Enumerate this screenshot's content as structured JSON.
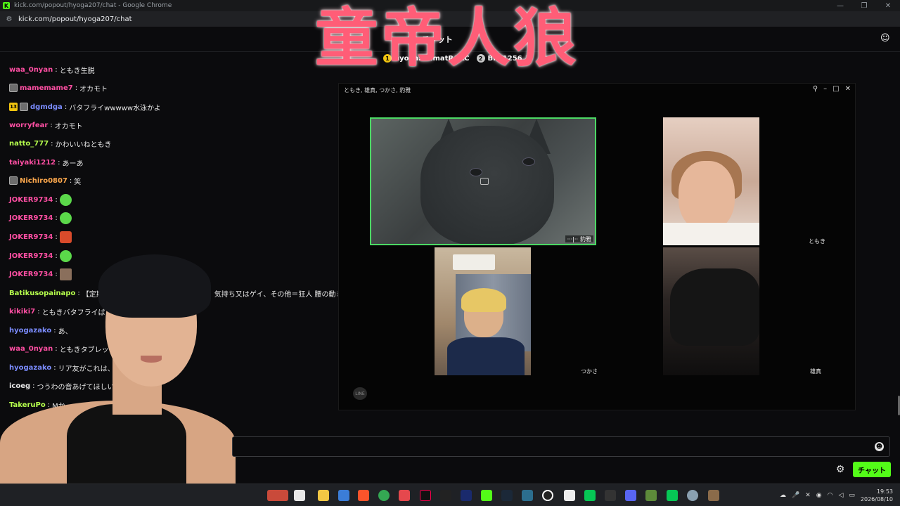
{
  "window": {
    "title": "kick.com/popout/hyoga207/chat - Google Chrome",
    "url": "kick.com/popout/hyoga207/chat"
  },
  "chat": {
    "header_title": "チャット",
    "pinned": [
      {
        "rank": "1",
        "name": "hyogazunmatRAKC",
        "count": ""
      },
      {
        "rank": "2",
        "name": "BFT1256",
        "count": "1"
      }
    ],
    "messages": [
      {
        "user": "waa_0nyan",
        "color": "#ff4fa3",
        "text": "ともき生脱"
      },
      {
        "user": "mamemame7",
        "color": "#ff4fa3",
        "text": "オカモト",
        "avatar": true
      },
      {
        "user": "dgmdga",
        "color": "#7b8cff",
        "text": "バタフライwwwww水泳かよ",
        "sub": "13",
        "avatar": true
      },
      {
        "user": "worryfear",
        "color": "#ff4fa3",
        "text": "オカモト"
      },
      {
        "user": "natto_777",
        "color": "#b6ff4d",
        "text": "かわいいねともき"
      },
      {
        "user": "taiyaki1212",
        "color": "#ff4fa3",
        "text": "あーあ"
      },
      {
        "user": "Nichiro0807",
        "color": "#ffa94d",
        "text": "笑",
        "avatar": true
      },
      {
        "user": "JOKER9734",
        "color": "#ff4fa3",
        "text": "",
        "emote": "green"
      },
      {
        "user": "JOKER9734",
        "color": "#ff4fa3",
        "text": "",
        "emote": "green"
      },
      {
        "user": "JOKER9734",
        "color": "#ff4fa3",
        "text": "",
        "emote": "red"
      },
      {
        "user": "JOKER9734",
        "color": "#ff4fa3",
        "text": "",
        "emote": "green"
      },
      {
        "user": "JOKER9734",
        "color": "#ff4fa3",
        "text": "",
        "emote": "face"
      },
      {
        "user": "Batikusopainapo",
        "color": "#b6ff4d",
        "text": "【定期】童",
        "tail": "気持ち又はゲイ、その他＝狂人 腰の動き・"
      },
      {
        "user": "kikiki7",
        "color": "#ff4fa3",
        "text": "ともきバタフライぱく"
      },
      {
        "user": "hyogazako",
        "color": "#7b8cff",
        "text": "あ、"
      },
      {
        "user": "waa_0nyan",
        "color": "#ff4fa3",
        "text": "ともきタブレットで"
      },
      {
        "user": "hyogazako",
        "color": "#7b8cff",
        "text": "リア友がこれは、"
      },
      {
        "user": "icoeg",
        "color": "#e6e6e6",
        "text": "つうわの音あげてほしい( ; △"
      },
      {
        "user": "TakeruPo",
        "color": "#b6ff4d",
        "text": "Mか"
      }
    ],
    "input_placeholder": "",
    "send_label": "チャット"
  },
  "overlay": {
    "title": "童帝人狼"
  },
  "call": {
    "title": "ともき, 雄真, つかさ, 豹雅",
    "participants": [
      {
        "name": "豹雅",
        "active": true
      },
      {
        "name": "ともき"
      },
      {
        "name": "つかさ"
      },
      {
        "name": "雄真"
      }
    ]
  },
  "taskbar": {
    "time": "19:53",
    "date": "2026/08/10"
  },
  "colors": {
    "accent": "#53fc18",
    "overlay_title": "#ff5d77",
    "active_speaker": "#4cd964"
  }
}
